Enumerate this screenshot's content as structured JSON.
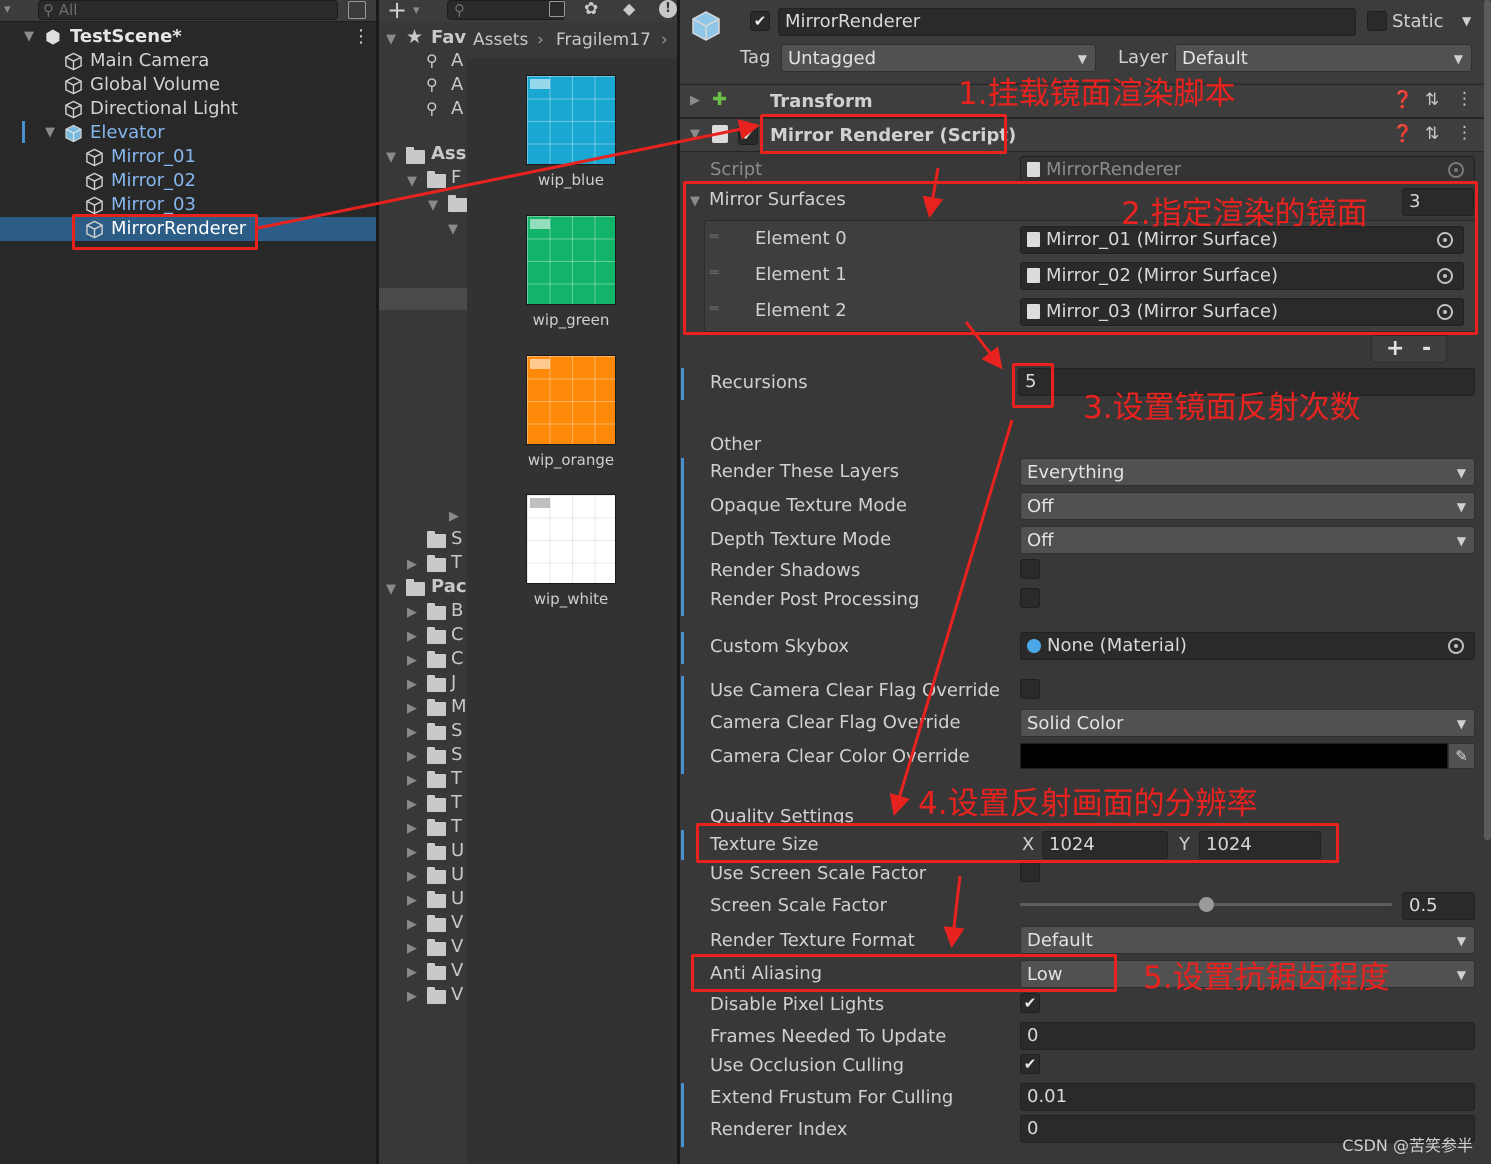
{
  "hierarchy": {
    "search_placeholder": "All",
    "scene": "TestScene*",
    "items": [
      {
        "label": "Main Camera",
        "indent": 1
      },
      {
        "label": "Global Volume",
        "indent": 1
      },
      {
        "label": "Directional Light",
        "indent": 1
      },
      {
        "label": "Elevator",
        "indent": 1
      },
      {
        "label": "Mirror_01",
        "indent": 2
      },
      {
        "label": "Mirror_02",
        "indent": 2
      },
      {
        "label": "Mirror_03",
        "indent": 2
      },
      {
        "label": "MirrorRenderer",
        "indent": 2
      }
    ]
  },
  "project": {
    "breadcrumb": [
      "Assets",
      "Fragilem17"
    ],
    "favorites_label": "Fav",
    "fav_items": [
      "A",
      "A",
      "A"
    ],
    "assets_label": "Ass",
    "assets_sub": "F",
    "tree_s": "S",
    "tree_t": "T",
    "packages_label": "Pac",
    "package_items": [
      "B",
      "C",
      "C",
      "J",
      "M",
      "S",
      "S",
      "T",
      "T",
      "T",
      "U",
      "U",
      "U",
      "V",
      "V",
      "V",
      "V"
    ],
    "thumbnails": [
      {
        "label": "wip_blue",
        "color": "#1aa7d2"
      },
      {
        "label": "wip_green",
        "color": "#13b36a"
      },
      {
        "label": "wip_orange",
        "color": "#ff8a0a"
      },
      {
        "label": "wip_white",
        "color": "#ffffff"
      }
    ]
  },
  "inspector": {
    "object_name": "MirrorRenderer",
    "static_label": "Static",
    "tag_label": "Tag",
    "tag_value": "Untagged",
    "layer_label": "Layer",
    "layer_value": "Default",
    "transform_label": "Transform",
    "component_label": "Mirror Renderer (Script)",
    "script_label": "Script",
    "script_value": "MirrorRenderer",
    "surfaces_label": "Mirror Surfaces",
    "surfaces_count": "3",
    "elements": [
      {
        "label": "Element 0",
        "value": "Mirror_01 (Mirror Surface)"
      },
      {
        "label": "Element 1",
        "value": "Mirror_02 (Mirror Surface)"
      },
      {
        "label": "Element 2",
        "value": "Mirror_03 (Mirror Surface)"
      }
    ],
    "add_label": "+",
    "remove_label": "-",
    "recursions_label": "Recursions",
    "recursions_value": "5",
    "other_label": "Other",
    "render_layers_label": "Render These Layers",
    "render_layers_value": "Everything",
    "opaque_label": "Opaque Texture Mode",
    "opaque_value": "Off",
    "depth_label": "Depth Texture Mode",
    "depth_value": "Off",
    "shadows_label": "Render Shadows",
    "post_label": "Render Post Processing",
    "skybox_label": "Custom Skybox",
    "skybox_value": "None (Material)",
    "clear_flag_override_label": "Use Camera Clear Flag Override",
    "clear_flag_label": "Camera Clear Flag Override",
    "clear_flag_value": "Solid Color",
    "clear_color_label": "Camera Clear Color Override",
    "clear_color_value": "#000000",
    "quality_label": "Quality Settings",
    "texture_size_label": "Texture Size",
    "tex_x_label": "X",
    "tex_x_value": "1024",
    "tex_y_label": "Y",
    "tex_y_value": "1024",
    "screen_scale_use_label": "Use Screen Scale Factor",
    "screen_scale_label": "Screen Scale Factor",
    "screen_scale_value": "0.5",
    "screen_scale_fraction": 0.5,
    "texture_format_label": "Render Texture Format",
    "texture_format_value": "Default",
    "anti_alias_label": "Anti Aliasing",
    "anti_alias_value": "Low",
    "disable_pixel_lights_label": "Disable Pixel Lights",
    "frames_label": "Frames Needed To Update",
    "frames_value": "0",
    "occlusion_label": "Use Occlusion Culling",
    "frustum_label": "Extend Frustum For Culling",
    "frustum_value": "0.01",
    "renderer_index_label": "Renderer Index",
    "renderer_index_value": "0"
  },
  "annotations": {
    "step1": "1.挂载镜面渲染脚本",
    "step2": "2.指定渲染的镜面",
    "step3": "3.设置镜面反射次数",
    "step4": "4.设置反射画面的分辨率",
    "step5": "5.设置抗锯齿程度",
    "color": "#e8231f"
  },
  "watermark": "CSDN @苦笑参半"
}
